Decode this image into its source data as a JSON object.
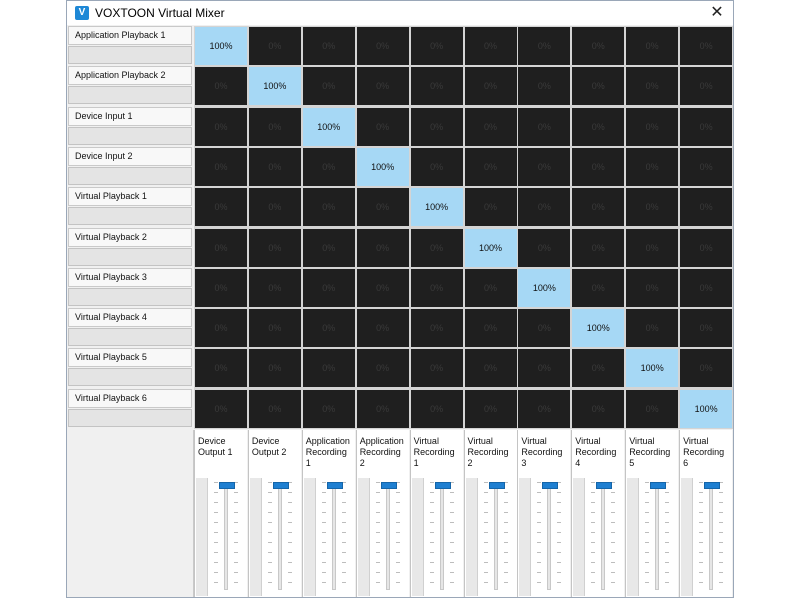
{
  "window": {
    "title": "VOXTOON Virtual Mixer",
    "app_icon": "V",
    "close_glyph": "✕",
    "accent": "#1e88d6"
  },
  "rows": [
    "Application Playback 1",
    "Application Playback 2",
    "Device Input 1",
    "Device Input 2",
    "Virtual Playback 1",
    "Virtual Playback 2",
    "Virtual Playback 3",
    "Virtual Playback 4",
    "Virtual Playback 5",
    "Virtual Playback 6"
  ],
  "outputs": [
    {
      "label": "Device\nOutput 1",
      "level": 1.0
    },
    {
      "label": "Device\nOutput 2",
      "level": 1.0
    },
    {
      "label": "Application\nRecording\n1",
      "level": 1.0
    },
    {
      "label": "Application\nRecording\n2",
      "level": 1.0
    },
    {
      "label": "Virtual\nRecording\n1",
      "level": 1.0
    },
    {
      "label": "Virtual\nRecording\n2",
      "level": 1.0
    },
    {
      "label": "Virtual\nRecording\n3",
      "level": 1.0
    },
    {
      "label": "Virtual\nRecording\n4",
      "level": 1.0
    },
    {
      "label": "Virtual\nRecording\n5",
      "level": 1.0
    },
    {
      "label": "Virtual\nRecording\n6",
      "level": 1.0
    }
  ],
  "matrix": [
    [
      "100%",
      "0%",
      "0%",
      "0%",
      "0%",
      "0%",
      "0%",
      "0%",
      "0%",
      "0%"
    ],
    [
      "0%",
      "100%",
      "0%",
      "0%",
      "0%",
      "0%",
      "0%",
      "0%",
      "0%",
      "0%"
    ],
    [
      "0%",
      "0%",
      "100%",
      "0%",
      "0%",
      "0%",
      "0%",
      "0%",
      "0%",
      "0%"
    ],
    [
      "0%",
      "0%",
      "0%",
      "100%",
      "0%",
      "0%",
      "0%",
      "0%",
      "0%",
      "0%"
    ],
    [
      "0%",
      "0%",
      "0%",
      "0%",
      "100%",
      "0%",
      "0%",
      "0%",
      "0%",
      "0%"
    ],
    [
      "0%",
      "0%",
      "0%",
      "0%",
      "0%",
      "100%",
      "0%",
      "0%",
      "0%",
      "0%"
    ],
    [
      "0%",
      "0%",
      "0%",
      "0%",
      "0%",
      "0%",
      "100%",
      "0%",
      "0%",
      "0%"
    ],
    [
      "0%",
      "0%",
      "0%",
      "0%",
      "0%",
      "0%",
      "0%",
      "100%",
      "0%",
      "0%"
    ],
    [
      "0%",
      "0%",
      "0%",
      "0%",
      "0%",
      "0%",
      "0%",
      "0%",
      "100%",
      "0%"
    ],
    [
      "0%",
      "0%",
      "0%",
      "0%",
      "0%",
      "0%",
      "0%",
      "0%",
      "0%",
      "100%"
    ]
  ],
  "colors": {
    "cell_off": "#1f1f1f",
    "cell_on": "#a6d8f5",
    "fader_thumb": "#1e7fd1"
  }
}
